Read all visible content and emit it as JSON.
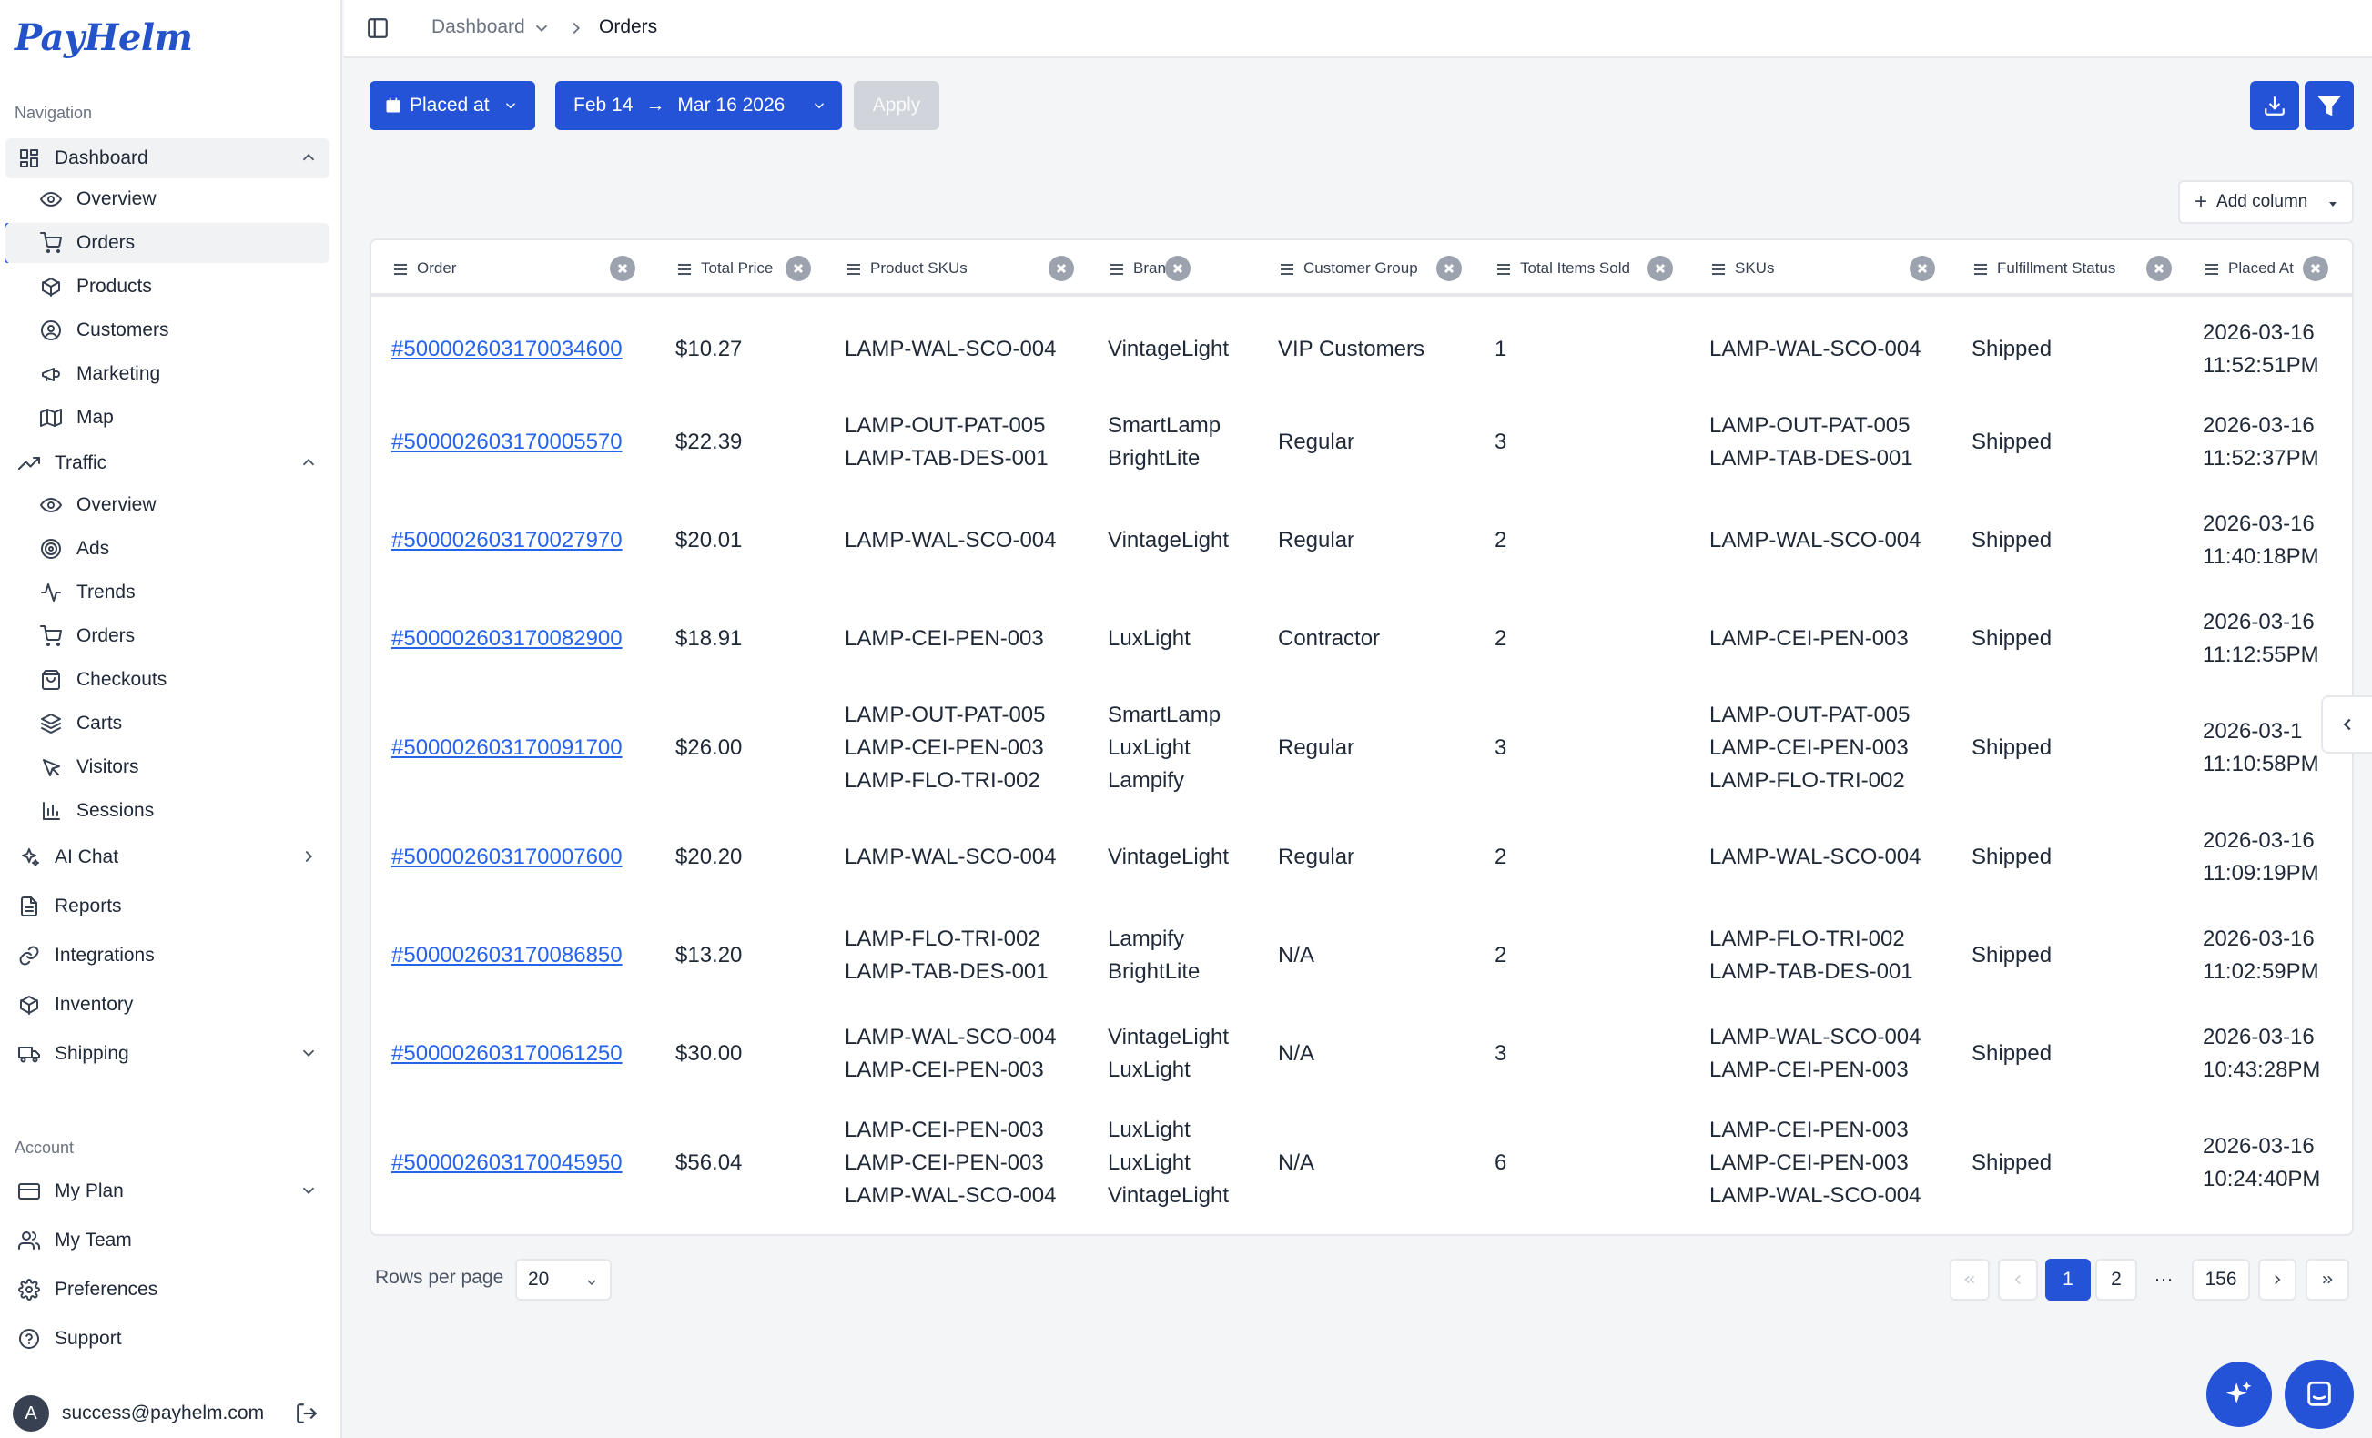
{
  "app": {
    "logo": "PayHelm"
  },
  "sidebar": {
    "navigation_label": "Navigation",
    "account_label": "Account",
    "dashboard": {
      "label": "Dashboard",
      "children": [
        "Overview",
        "Orders",
        "Products",
        "Customers",
        "Marketing",
        "Map"
      ]
    },
    "traffic": {
      "label": "Traffic",
      "children": [
        "Overview",
        "Ads",
        "Trends",
        "Orders",
        "Checkouts",
        "Carts",
        "Visitors",
        "Sessions"
      ]
    },
    "ai_chat": "AI Chat",
    "reports": "Reports",
    "integrations": "Integrations",
    "inventory": "Inventory",
    "shipping": "Shipping",
    "my_plan": "My Plan",
    "my_team": "My Team",
    "preferences": "Preferences",
    "support": "Support",
    "user": {
      "initial": "A",
      "email": "success@payhelm.com"
    }
  },
  "breadcrumb": {
    "parent": "Dashboard",
    "current": "Orders"
  },
  "filters": {
    "date_field": "Placed at",
    "date_from": "Feb 14",
    "date_arrow": "→",
    "date_to": "Mar 16 2026",
    "apply": "Apply"
  },
  "table": {
    "add_column": "Add column",
    "columns": [
      "Order",
      "Total Price",
      "Product SKUs",
      "Brands",
      "Customer Group",
      "Total Items Sold",
      "SKUs",
      "Fulfillment Status",
      "Placed At"
    ],
    "rows": [
      {
        "order": "#500002603170034600",
        "price": "$10.27",
        "product_skus": [
          "LAMP-WAL-SCO-004"
        ],
        "brands": [
          "VintageLight"
        ],
        "group": "VIP Customers",
        "items": "1",
        "skus": [
          "LAMP-WAL-SCO-004"
        ],
        "status": "Shipped",
        "placed": [
          "2026-03-16",
          "11:52:51PM"
        ]
      },
      {
        "order": "#500002603170005570",
        "price": "$22.39",
        "product_skus": [
          "LAMP-OUT-PAT-005",
          "LAMP-TAB-DES-001"
        ],
        "brands": [
          "SmartLamp",
          "BrightLite"
        ],
        "group": "Regular",
        "items": "3",
        "skus": [
          "LAMP-OUT-PAT-005",
          "LAMP-TAB-DES-001"
        ],
        "status": "Shipped",
        "placed": [
          "2026-03-16",
          "11:52:37PM"
        ]
      },
      {
        "order": "#500002603170027970",
        "price": "$20.01",
        "product_skus": [
          "LAMP-WAL-SCO-004"
        ],
        "brands": [
          "VintageLight"
        ],
        "group": "Regular",
        "items": "2",
        "skus": [
          "LAMP-WAL-SCO-004"
        ],
        "status": "Shipped",
        "placed": [
          "2026-03-16",
          "11:40:18PM"
        ]
      },
      {
        "order": "#500002603170082900",
        "price": "$18.91",
        "product_skus": [
          "LAMP-CEI-PEN-003"
        ],
        "brands": [
          "LuxLight"
        ],
        "group": "Contractor",
        "items": "2",
        "skus": [
          "LAMP-CEI-PEN-003"
        ],
        "status": "Shipped",
        "placed": [
          "2026-03-16",
          "11:12:55PM"
        ]
      },
      {
        "order": "#500002603170091700",
        "price": "$26.00",
        "product_skus": [
          "LAMP-OUT-PAT-005",
          "LAMP-CEI-PEN-003",
          "LAMP-FLO-TRI-002"
        ],
        "brands": [
          "SmartLamp",
          "LuxLight",
          "Lampify"
        ],
        "group": "Regular",
        "items": "3",
        "skus": [
          "LAMP-OUT-PAT-005",
          "LAMP-CEI-PEN-003",
          "LAMP-FLO-TRI-002"
        ],
        "status": "Shipped",
        "placed": [
          "2026-03-1",
          "11:10:58PM"
        ]
      },
      {
        "order": "#500002603170007600",
        "price": "$20.20",
        "product_skus": [
          "LAMP-WAL-SCO-004"
        ],
        "brands": [
          "VintageLight"
        ],
        "group": "Regular",
        "items": "2",
        "skus": [
          "LAMP-WAL-SCO-004"
        ],
        "status": "Shipped",
        "placed": [
          "2026-03-16",
          "11:09:19PM"
        ]
      },
      {
        "order": "#500002603170086850",
        "price": "$13.20",
        "product_skus": [
          "LAMP-FLO-TRI-002",
          "LAMP-TAB-DES-001"
        ],
        "brands": [
          "Lampify",
          "BrightLite"
        ],
        "group": "N/A",
        "items": "2",
        "skus": [
          "LAMP-FLO-TRI-002",
          "LAMP-TAB-DES-001"
        ],
        "status": "Shipped",
        "placed": [
          "2026-03-16",
          "11:02:59PM"
        ]
      },
      {
        "order": "#500002603170061250",
        "price": "$30.00",
        "product_skus": [
          "LAMP-WAL-SCO-004",
          "LAMP-CEI-PEN-003"
        ],
        "brands": [
          "VintageLight",
          "LuxLight"
        ],
        "group": "N/A",
        "items": "3",
        "skus": [
          "LAMP-WAL-SCO-004",
          "LAMP-CEI-PEN-003"
        ],
        "status": "Shipped",
        "placed": [
          "2026-03-16",
          "10:43:28PM"
        ]
      },
      {
        "order": "#500002603170045950",
        "price": "$56.04",
        "product_skus": [
          "LAMP-CEI-PEN-003",
          "LAMP-CEI-PEN-003",
          "LAMP-WAL-SCO-004"
        ],
        "brands": [
          "LuxLight",
          "LuxLight",
          "VintageLight"
        ],
        "group": "N/A",
        "items": "6",
        "skus": [
          "LAMP-CEI-PEN-003",
          "LAMP-CEI-PEN-003",
          "LAMP-WAL-SCO-004"
        ],
        "status": "Shipped",
        "placed": [
          "2026-03-16",
          "10:24:40PM"
        ]
      }
    ]
  },
  "pagination": {
    "rows_per_page_label": "Rows per page",
    "rows_per_page": "20",
    "pages": [
      "1",
      "2"
    ],
    "ellipsis": "···",
    "last_page": "156",
    "current_page": "1"
  },
  "colors": {
    "accent": "#2453d8",
    "link": "#2563eb"
  }
}
